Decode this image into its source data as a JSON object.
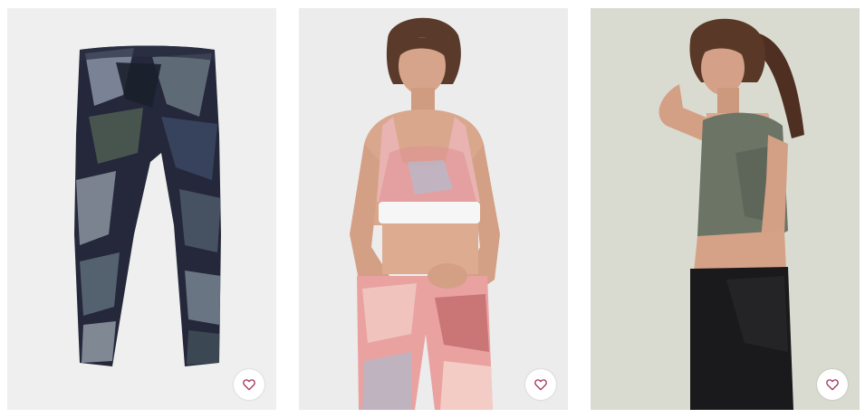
{
  "products": [
    {
      "image_icon": "patterned-leggings-image",
      "favorite_icon": "heart-outline-icon",
      "background": "#efefef"
    },
    {
      "image_icon": "model-pink-sports-bra-leggings-image",
      "favorite_icon": "heart-outline-icon",
      "background": "#ececec"
    },
    {
      "image_icon": "model-green-crop-top-black-leggings-image",
      "favorite_icon": "heart-outline-icon",
      "background": "#d9dbd0"
    }
  ],
  "colors": {
    "heart_accent": "#a0345c",
    "button_bg": "#ffffff"
  }
}
